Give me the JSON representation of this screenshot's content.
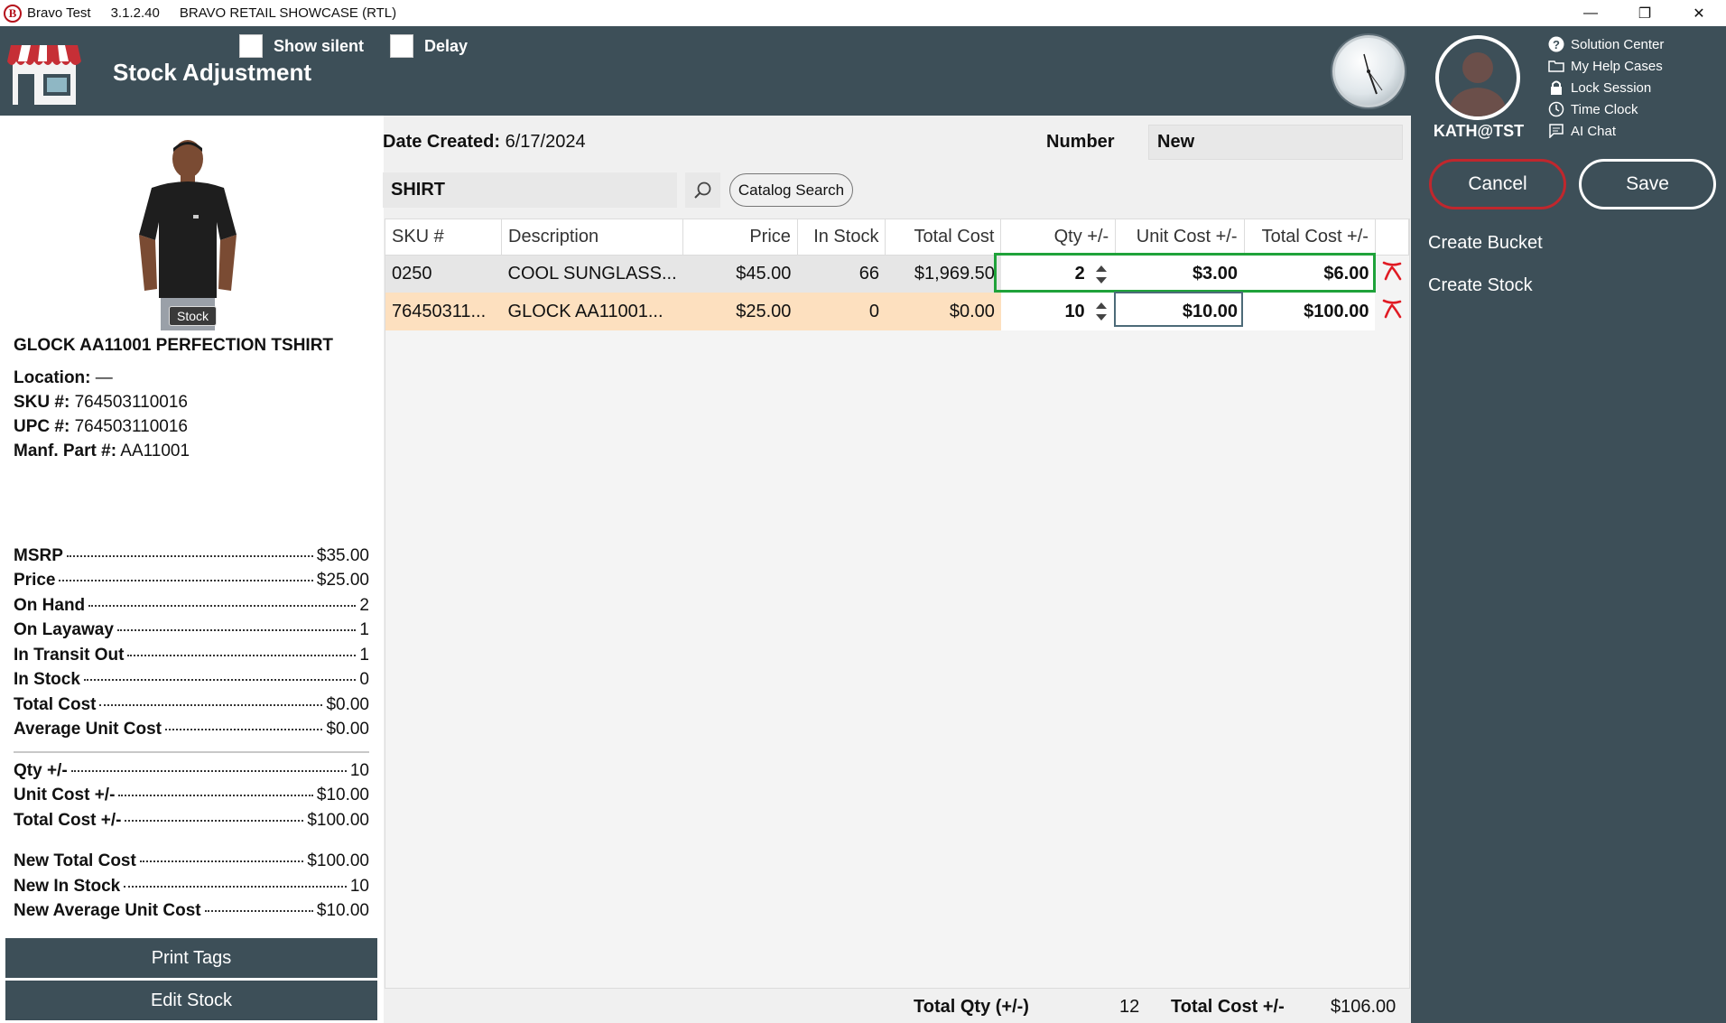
{
  "titlebar": {
    "logo_letter": "B",
    "app_name": "Bravo Test",
    "version": "3.1.2.40",
    "store": "BRAVO RETAIL SHOWCASE (RTL)",
    "minimize": "—",
    "restore": "❐",
    "close": "✕"
  },
  "header": {
    "title": "Stock Adjustment",
    "show_silent_label": "Show silent",
    "delay_label": "Delay"
  },
  "user": {
    "name": "KATH@TST",
    "links": [
      {
        "label": "Solution Center",
        "icon": "question-icon"
      },
      {
        "label": "My Help Cases",
        "icon": "folder-icon"
      },
      {
        "label": "Lock Session",
        "icon": "lock-icon"
      },
      {
        "label": "Time Clock",
        "icon": "clock-icon"
      },
      {
        "label": "AI Chat",
        "icon": "chat-icon"
      }
    ],
    "cancel_label": "Cancel",
    "save_label": "Save",
    "create_bucket_label": "Create Bucket",
    "create_stock_label": "Create Stock"
  },
  "product": {
    "stock_tag": "Stock",
    "name": "GLOCK AA11001 PERFECTION TSHIRT",
    "location_label": "Location:",
    "location_value": "—",
    "sku_label": "SKU #:",
    "sku_value": "764503110016",
    "upc_label": "UPC #:",
    "upc_value": "764503110016",
    "manf_label": "Manf. Part #:",
    "manf_value": "AA11001",
    "stats": [
      {
        "label": "MSRP",
        "value": "$35.00"
      },
      {
        "label": "Price",
        "value": "$25.00"
      },
      {
        "label": "On Hand",
        "value": "2"
      },
      {
        "label": "On Layaway",
        "value": "1"
      },
      {
        "label": "In Transit Out",
        "value": "1"
      },
      {
        "label": "In Stock",
        "value": "0"
      },
      {
        "label": "Total Cost",
        "value": "$0.00"
      },
      {
        "label": "Average Unit Cost",
        "value": "$0.00"
      },
      {
        "label": "Qty +/-",
        "value": "10"
      },
      {
        "label": "Unit Cost +/-",
        "value": "$10.00"
      },
      {
        "label": "Total Cost +/-",
        "value": "$100.00"
      },
      {
        "label": "New Total Cost",
        "value": "$100.00"
      },
      {
        "label": "New In Stock",
        "value": "10"
      },
      {
        "label": "New Average Unit Cost",
        "value": "$10.00"
      }
    ],
    "print_tags_label": "Print Tags",
    "edit_stock_label": "Edit Stock"
  },
  "form": {
    "date_created_label": "Date Created:",
    "date_created_value": "6/17/2024",
    "number_label": "Number",
    "number_value": "New",
    "search_value": "SHIRT",
    "catalog_search_label": "Catalog Search"
  },
  "grid": {
    "columns": [
      "SKU #",
      "Description",
      "Price",
      "In Stock",
      "Total Cost",
      "Qty +/-",
      "Unit Cost +/-",
      "Total Cost +/-"
    ],
    "rows": [
      {
        "sku": "0250",
        "description": "COOL SUNGLASS...",
        "price": "$45.00",
        "in_stock": "66",
        "total_cost": "$1,969.50",
        "qty": "2",
        "unit_cost": "$3.00",
        "total_cost_adj": "$6.00"
      },
      {
        "sku": "76450311...",
        "description": "GLOCK AA11001...",
        "price": "$25.00",
        "in_stock": "0",
        "total_cost": "$0.00",
        "qty": "10",
        "unit_cost": "$10.00",
        "total_cost_adj": "$100.00"
      }
    ]
  },
  "totals": {
    "qty_label": "Total Qty (+/-)",
    "qty_value": "12",
    "cost_label": "Total Cost +/-",
    "cost_value": "$106.00"
  },
  "colors": {
    "header_bg": "#3d4f58",
    "selected_row": "#fde0bf",
    "highlight_border": "#1fa23a",
    "cancel_border": "#c0272d",
    "delete_icon": "#e01b24"
  }
}
